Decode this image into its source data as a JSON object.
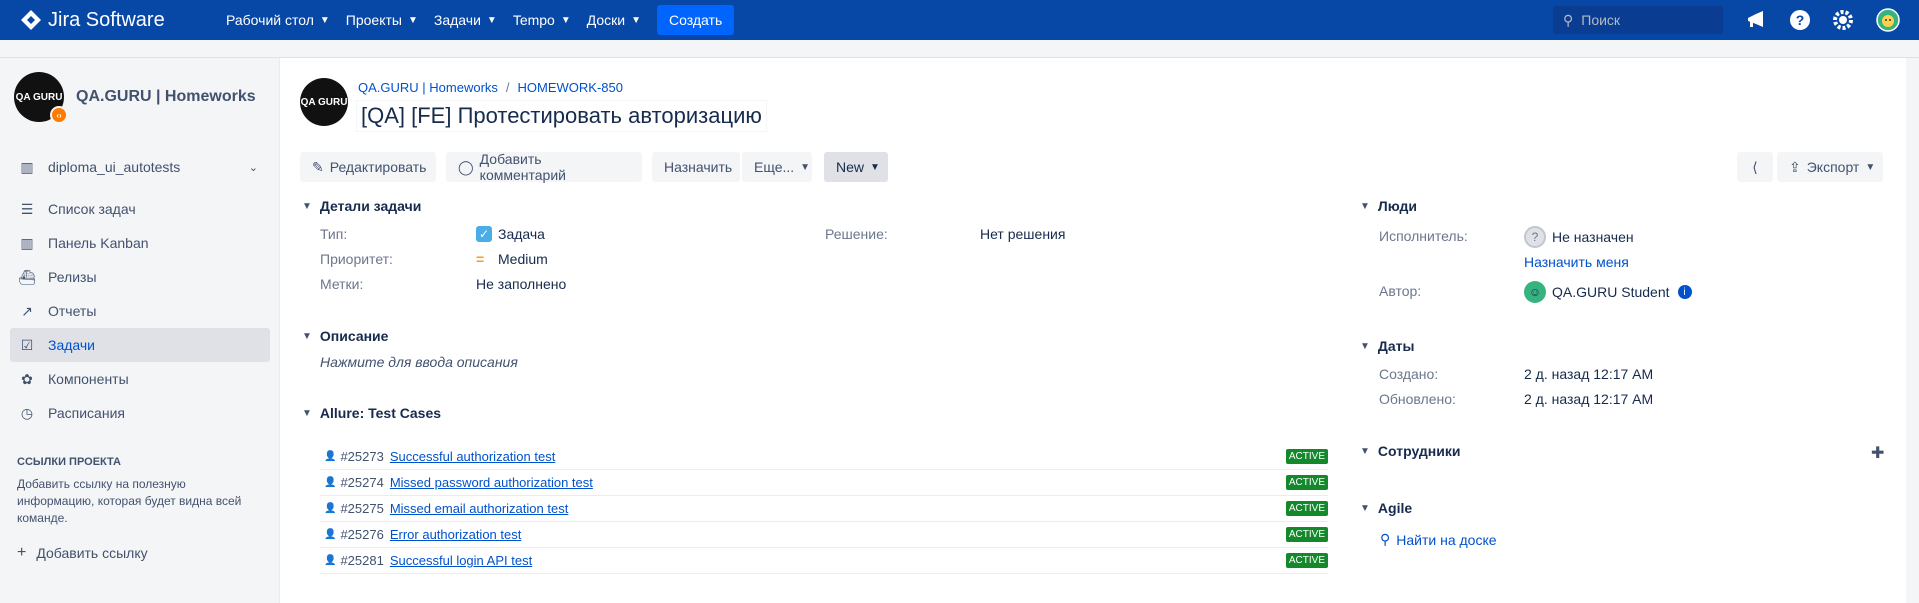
{
  "topnav": {
    "brand": "Jira Software",
    "menu": [
      {
        "label": "Рабочий стол"
      },
      {
        "label": "Проекты"
      },
      {
        "label": "Задачи"
      },
      {
        "label": "Tempo"
      },
      {
        "label": "Доски"
      }
    ],
    "create_label": "Создать",
    "search_placeholder": "Поиск"
  },
  "sidebar": {
    "project_name": "QA.GURU | Homeworks",
    "project_avatar_text": "QA GURU",
    "board": "diploma_ui_autotests",
    "items": [
      {
        "label": "Список задач",
        "icon": "backlog-icon"
      },
      {
        "label": "Панель Kanban",
        "icon": "board-icon"
      },
      {
        "label": "Релизы",
        "icon": "ship-icon"
      },
      {
        "label": "Отчеты",
        "icon": "chart-icon"
      },
      {
        "label": "Задачи",
        "icon": "issues-icon",
        "active": true
      },
      {
        "label": "Компоненты",
        "icon": "component-icon"
      },
      {
        "label": "Расписания",
        "icon": "clock-icon"
      }
    ],
    "links_heading": "ССЫЛКИ ПРОЕКТА",
    "links_note": "Добавить ссылку на полезную информацию, которая будет видна всей команде.",
    "add_link": "Добавить ссылку"
  },
  "issue": {
    "breadcrumb_project": "QA.GURU | Homeworks",
    "breadcrumb_key": "HOMEWORK-850",
    "breadcrumb_sep": "/",
    "title": "[QA] [FE] Протестировать авторизацию",
    "buttons": {
      "edit": "Редактировать",
      "comment": "Добавить комментарий",
      "assign": "Назначить",
      "more": "Еще...",
      "status": "New",
      "export": "Экспорт"
    }
  },
  "details": {
    "heading": "Детали задачи",
    "type_label": "Тип:",
    "type_value": "Задача",
    "priority_label": "Приоритет:",
    "priority_value": "Medium",
    "labels_label": "Метки:",
    "labels_value": "Не заполнено",
    "resolution_label": "Решение:",
    "resolution_value": "Нет решения"
  },
  "description": {
    "heading": "Описание",
    "placeholder": "Нажмите для ввода описания"
  },
  "allure": {
    "heading": "Allure: Test Cases",
    "cases": [
      {
        "id": "#25273",
        "name": "Successful authorization test",
        "status": "ACTIVE"
      },
      {
        "id": "#25274",
        "name": "Missed password authorization test",
        "status": "ACTIVE"
      },
      {
        "id": "#25275",
        "name": "Missed email authorization test",
        "status": "ACTIVE"
      },
      {
        "id": "#25276",
        "name": "Error authorization test",
        "status": "ACTIVE"
      },
      {
        "id": "#25281",
        "name": "Successful login API test",
        "status": "ACTIVE"
      }
    ]
  },
  "people": {
    "heading": "Люди",
    "assignee_label": "Исполнитель:",
    "assignee_value": "Не назначен",
    "assign_me": "Назначить меня",
    "reporter_label": "Автор:",
    "reporter_value": "QA.GURU Student"
  },
  "dates": {
    "heading": "Даты",
    "created_label": "Создано:",
    "created_value": "2 д. назад 12:17 AM",
    "updated_label": "Обновлено:",
    "updated_value": "2 д. назад 12:17 AM"
  },
  "employees": {
    "heading": "Сотрудники"
  },
  "agile": {
    "heading": "Agile",
    "find_on_board": "Найти на доске"
  },
  "colors": {
    "nav": "#0747a6",
    "link": "#0052cc",
    "active_badge": "#14892c"
  }
}
